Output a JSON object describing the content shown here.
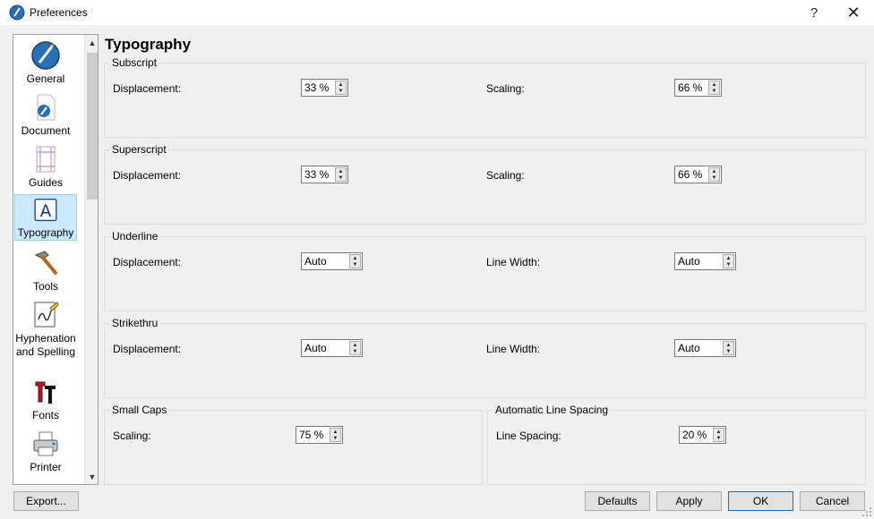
{
  "window": {
    "title": "Preferences",
    "help": "?",
    "close": "✕"
  },
  "sidebar": {
    "items": [
      {
        "label": "General"
      },
      {
        "label": "Document"
      },
      {
        "label": "Guides"
      },
      {
        "label": "Typography"
      },
      {
        "label": "Tools"
      },
      {
        "label": "Hyphenation and Spelling"
      },
      {
        "label": "Fonts"
      },
      {
        "label": "Printer"
      }
    ],
    "selected": "Typography"
  },
  "page": {
    "title": "Typography"
  },
  "subscript": {
    "title": "Subscript",
    "displacement_label": "Displacement:",
    "displacement_value": "33 %",
    "scaling_label": "Scaling:",
    "scaling_value": "66 %"
  },
  "superscript": {
    "title": "Superscript",
    "displacement_label": "Displacement:",
    "displacement_value": "33 %",
    "scaling_label": "Scaling:",
    "scaling_value": "66 %"
  },
  "underline": {
    "title": "Underline",
    "displacement_label": "Displacement:",
    "displacement_value": "Auto",
    "linewidth_label": "Line Width:",
    "linewidth_value": "Auto"
  },
  "strikethru": {
    "title": "Strikethru",
    "displacement_label": "Displacement:",
    "displacement_value": "Auto",
    "linewidth_label": "Line Width:",
    "linewidth_value": "Auto"
  },
  "smallcaps": {
    "title": "Small Caps",
    "scaling_label": "Scaling:",
    "scaling_value": "75 %"
  },
  "linespacing": {
    "title": "Automatic Line Spacing",
    "label": "Line Spacing:",
    "value": "20 %"
  },
  "buttons": {
    "export": "Export...",
    "defaults": "Defaults",
    "apply": "Apply",
    "ok": "OK",
    "cancel": "Cancel"
  },
  "colors": {
    "selection": "#cce8ff",
    "accent": "#2a6fb5"
  }
}
